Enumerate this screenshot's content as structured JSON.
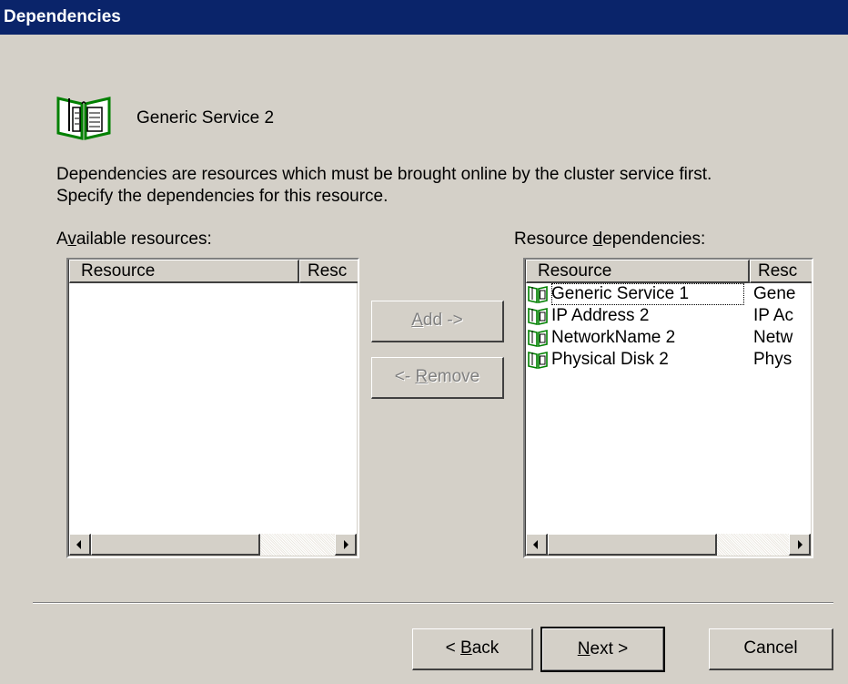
{
  "window": {
    "title": "Dependencies"
  },
  "resource": {
    "name": "Generic Service 2",
    "icon": "resource-book-icon"
  },
  "description": {
    "line1": "Dependencies are resources which must be brought online by the cluster service first.",
    "line2": "Specify the dependencies for this resource."
  },
  "available": {
    "label_pre": "A",
    "label_accel": "v",
    "label_post": "ailable resources:",
    "columns": [
      "Resource",
      "Resc"
    ],
    "rows": []
  },
  "dependencies": {
    "label_pre": "Resource ",
    "label_accel": "d",
    "label_post": "ependencies:",
    "columns": [
      "Resource",
      "Resc"
    ],
    "rows": [
      {
        "name": "Generic Service 1",
        "type": "Gene"
      },
      {
        "name": "IP Address 2",
        "type": "IP Ac"
      },
      {
        "name": "NetworkName 2",
        "type": "Netw"
      },
      {
        "name": "Physical Disk 2",
        "type": "Phys"
      }
    ]
  },
  "buttons": {
    "add": {
      "accel": "A",
      "rest": "dd ->"
    },
    "remove": {
      "pre": "<- ",
      "accel": "R",
      "rest": "emove"
    },
    "back": {
      "pre": "< ",
      "accel": "B",
      "rest": "ack"
    },
    "next": {
      "accel": "N",
      "rest": "ext >"
    },
    "cancel": "Cancel"
  },
  "colors": {
    "titlebar": "#0a246a",
    "face": "#d4d0c8",
    "icon_green": "#008000"
  }
}
